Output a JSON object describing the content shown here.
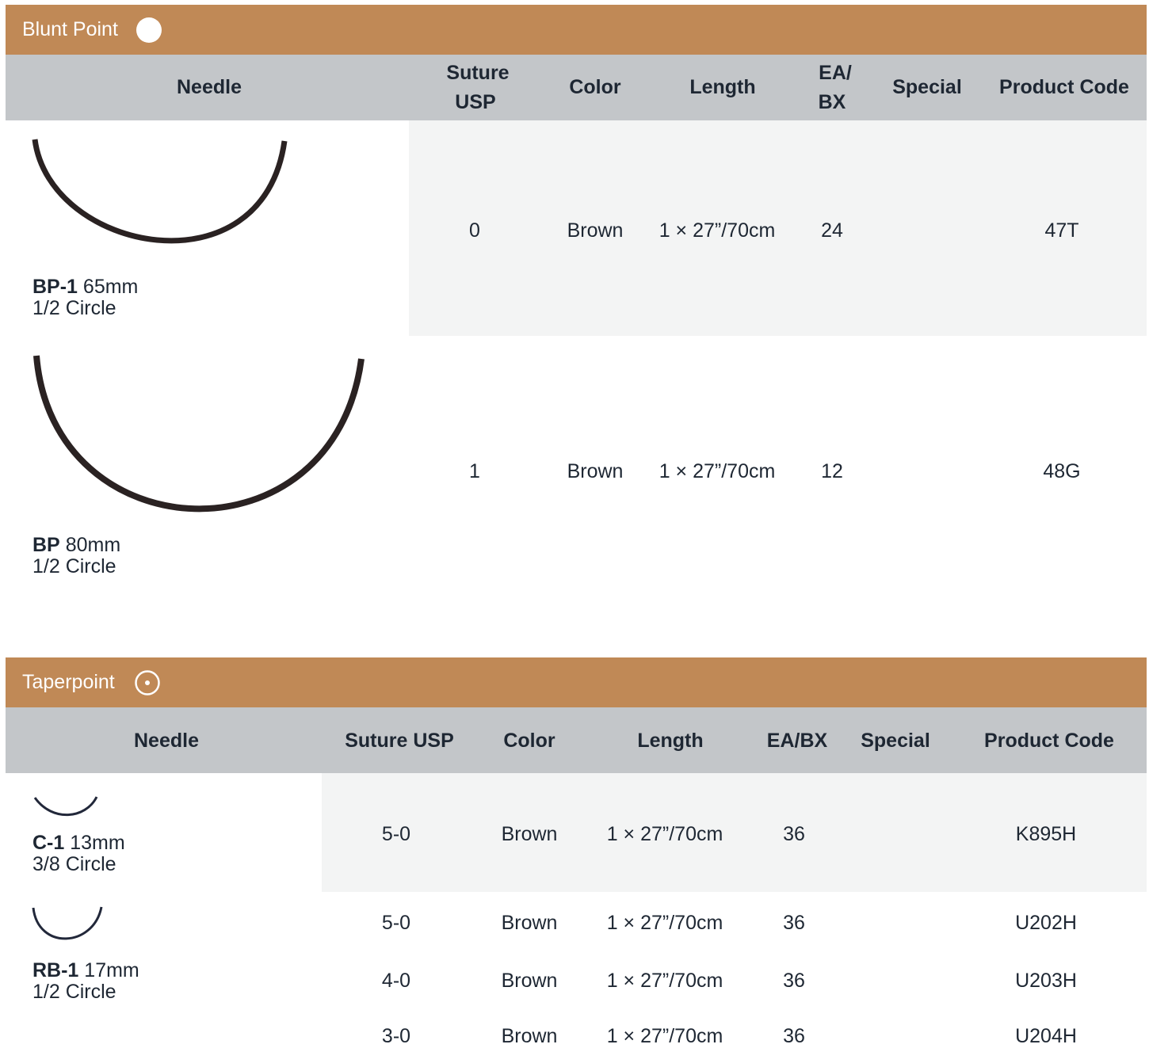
{
  "sections": [
    {
      "title": "Blunt Point",
      "icon": "solid-circle-icon",
      "headers": {
        "needle": "Needle",
        "suture_usp_line1": "Suture",
        "suture_usp_line2": "USP",
        "color": "Color",
        "length": "Length",
        "ea_bx_line1": "EA/",
        "ea_bx_line2": "BX",
        "special": "Special",
        "product_code": "Product Code"
      },
      "needles": [
        {
          "code": "BP-1",
          "size": "65mm",
          "shape": "1/2 Circle",
          "rows": [
            {
              "suture_usp": "0",
              "color": "Brown",
              "length": "1 × 27”/70cm",
              "ea_bx": "24",
              "special": "",
              "product_code": "47T"
            }
          ]
        },
        {
          "code": "BP",
          "size": "80mm",
          "shape": "1/2 Circle",
          "rows": [
            {
              "suture_usp": "1",
              "color": "Brown",
              "length": "1 × 27”/70cm",
              "ea_bx": "12",
              "special": "",
              "product_code": "48G"
            }
          ]
        }
      ]
    },
    {
      "title": "Taperpoint",
      "icon": "circle-dot-icon",
      "headers": {
        "needle": "Needle",
        "suture_usp": "Suture USP",
        "color": "Color",
        "length": "Length",
        "ea_bx": "EA/BX",
        "special": "Special",
        "product_code": "Product Code"
      },
      "needles": [
        {
          "code": "C-1",
          "size": "13mm",
          "shape": "3/8 Circle",
          "rows": [
            {
              "suture_usp": "5-0",
              "color": "Brown",
              "length": "1 × 27”/70cm",
              "ea_bx": "36",
              "special": "",
              "product_code": "K895H"
            }
          ]
        },
        {
          "code": "RB-1",
          "size": "17mm",
          "shape": "1/2 Circle",
          "rows": [
            {
              "suture_usp": "5-0",
              "color": "Brown",
              "length": "1 × 27”/70cm",
              "ea_bx": "36",
              "special": "",
              "product_code": "U202H"
            },
            {
              "suture_usp": "4-0",
              "color": "Brown",
              "length": "1 × 27”/70cm",
              "ea_bx": "36",
              "special": "",
              "product_code": "U203H"
            },
            {
              "suture_usp": "3-0",
              "color": "Brown",
              "length": "1 × 27”/70cm",
              "ea_bx": "36",
              "special": "",
              "product_code": "U204H"
            }
          ]
        }
      ]
    }
  ],
  "colors": {
    "section_band": "#c08956",
    "header_bg": "#c3c6c9",
    "row_shade": "#f3f4f4",
    "text": "#1e2733"
  }
}
